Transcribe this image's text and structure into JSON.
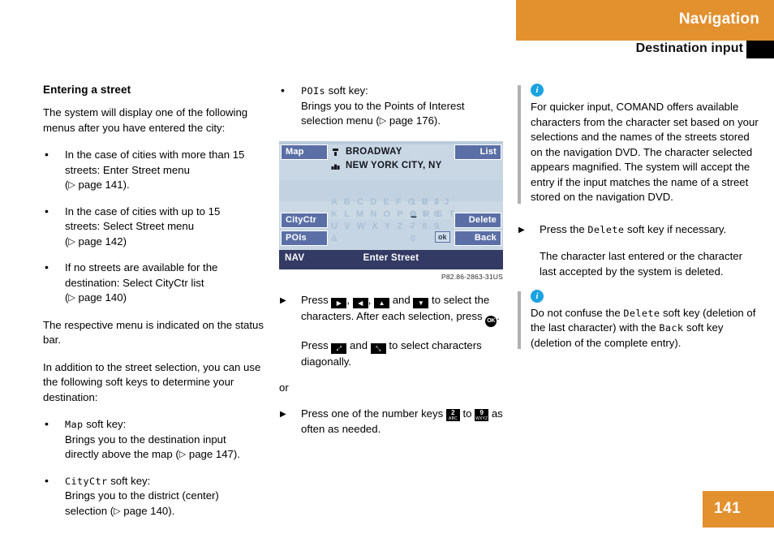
{
  "header": {
    "section": "Navigation",
    "subsection": "Destination input"
  },
  "footer": {
    "page_number": "141"
  },
  "colors": {
    "brand_orange": "#e3902f",
    "note_blue": "#1ba3e0",
    "softkey_blue": "#5b6fa6",
    "status_bar": "#333a63",
    "screen_bg": "#c8d6e3"
  },
  "left_column": {
    "title": "Entering a street",
    "intro": "The system will display one of the following menus after you have entered the city:",
    "bullets": [
      {
        "line1": "In the case of cities with more than 15",
        "line2": "streets: Enter Street menu",
        "ref": "page 141",
        "ref_suffix": ")."
      },
      {
        "line1": "In the case of cities with up to 15",
        "line2": "streets: Select Street menu",
        "ref": "page 142",
        "ref_suffix": ")"
      },
      {
        "line1": "If no streets are available for the",
        "line2": "destination: Select CityCtr list",
        "ref": "page 140",
        "ref_suffix": ")"
      }
    ],
    "para_status": "The respective menu is indicated on the status bar.",
    "para_addition": "In addition to the street selection, you can use the following soft keys to determine your destination:",
    "softkey_bullets": [
      {
        "key": "Map",
        "after_key": " soft key:",
        "desc_line1": "Brings you to the destination input",
        "desc_line2_pre": "directly above the map (",
        "ref": "page 147",
        "desc_line2_post": ")."
      },
      {
        "key": "CityCtr",
        "after_key": " soft key:",
        "desc_line1": "Brings you to the district (center)",
        "desc_line2_pre": "selection (",
        "ref": "page 140",
        "desc_line2_post": ")."
      }
    ]
  },
  "middle_column": {
    "softkey_bullet": {
      "key": "POIs",
      "after_key": " soft key:",
      "desc_line1": "Brings you to the Points of Interest",
      "desc_line2_pre": "selection menu (",
      "ref": "page 176",
      "desc_line2_post": ")."
    },
    "device": {
      "softkeys_left": [
        {
          "label": "Map"
        },
        {
          "label": "CityCtr"
        },
        {
          "label": "POIs"
        }
      ],
      "softkeys_right": [
        {
          "label": "List"
        },
        {
          "label": "Delete"
        },
        {
          "label": "Back"
        }
      ],
      "entry": {
        "street": "BROADWAY",
        "city": "NEW YORK CITY, NY",
        "street_icon": "street-sign-icon",
        "city_icon": "city-buildings-icon"
      },
      "charpad": {
        "rows": [
          {
            "letters": "A B C D E F G H I J",
            "digits": "1 2 3"
          },
          {
            "letters": "K L M N O P Q R S T",
            "digits": "4 5 6"
          },
          {
            "letters": "U V W X Y Z - ` . ,",
            "digits": "7 8 9"
          },
          {
            "letters": "&",
            "digits": "0"
          }
        ],
        "selected_character": "–",
        "ok_key": "ok"
      },
      "status_bar": {
        "mode": "NAV",
        "title": "Enter Street"
      }
    },
    "figure_caption": "P82.86-2863-31US",
    "steps": [
      {
        "text_pre": "Press ",
        "keys": [
          "right-arrow-key",
          "left-arrow-key",
          "up-arrow-key",
          "down-arrow-key"
        ],
        "text_mid": " to select the characters. After each selection, press ",
        "ok_key": "OK",
        "text_post": "."
      }
    ],
    "diagonal_note": {
      "text_pre": "Press ",
      "key1": "diagonal-down-right-key",
      "text_mid": " and ",
      "key2": "diagonal-up-right-key",
      "text_post": " to select characters diagonally."
    },
    "or_label": "or",
    "number_step": {
      "text_pre": "Press one of the number keys ",
      "key_from": {
        "digit": "2",
        "letters": "ABC"
      },
      "text_mid": " to ",
      "key_to": {
        "digit": "9",
        "letters": "WXYZ"
      },
      "text_post": " as often as needed."
    }
  },
  "right_column": {
    "note1": {
      "icon": "info-icon",
      "text": "For quicker input, COMAND offers available characters from the character set based on your selections and the names of the streets stored on the navigation DVD. The character selected appears magnified. The system will accept the entry if the input matches the name of a street stored on the navigation DVD."
    },
    "step": {
      "text_pre": "Press the ",
      "key": "Delete",
      "text_post": " soft key if necessary."
    },
    "step_detail": "The character last entered or the character last accepted by the system is deleted.",
    "note2": {
      "icon": "info-icon",
      "text_pre": "Do not confuse the ",
      "key1": "Delete",
      "text_mid": " soft key (deletion of the last character) with the ",
      "key2": "Back",
      "text_post": " soft key (deletion of the complete entry)."
    }
  }
}
